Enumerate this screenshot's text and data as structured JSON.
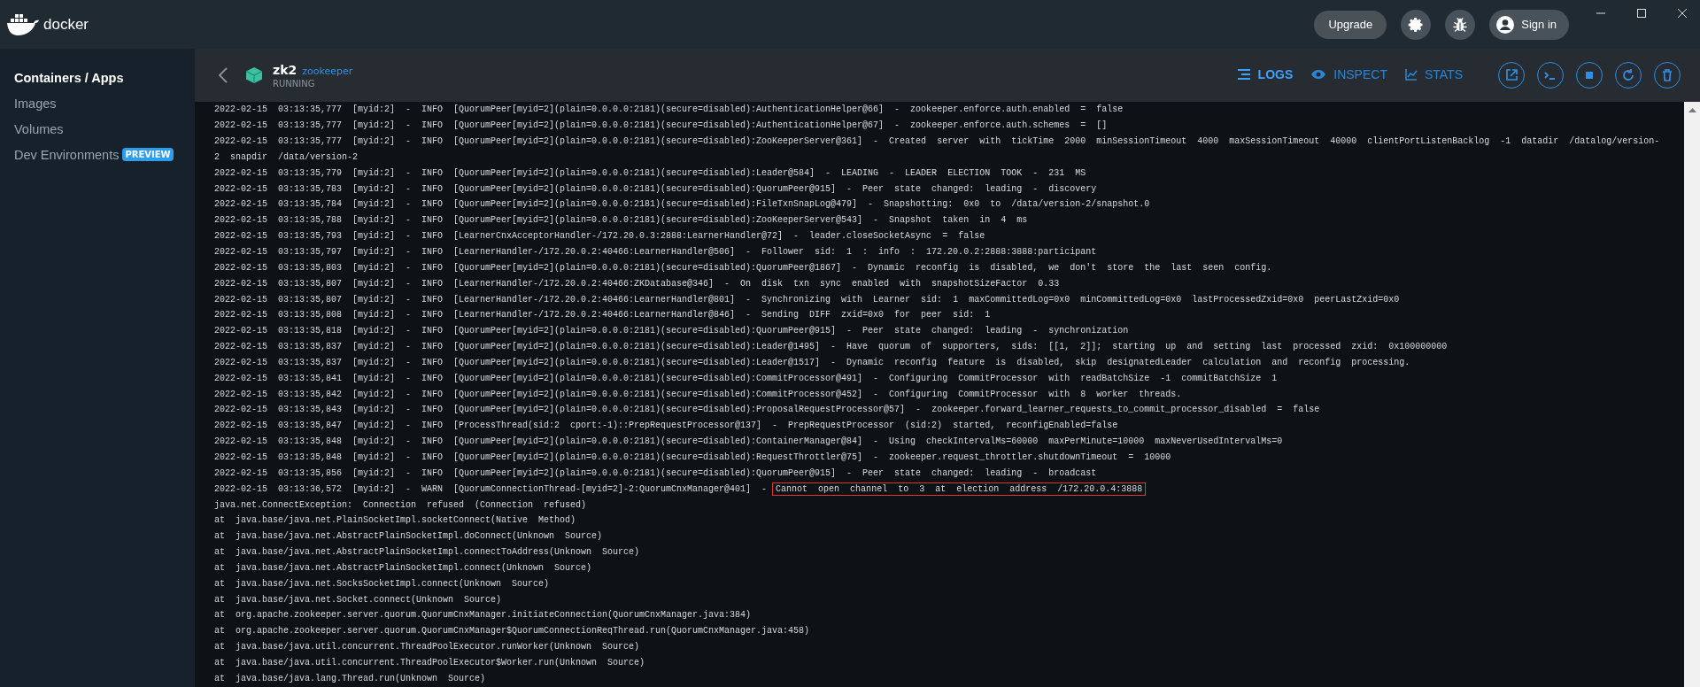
{
  "app": {
    "brand": "docker"
  },
  "header": {
    "upgrade": "Upgrade",
    "sign_in": "Sign in"
  },
  "sidebar": {
    "items": [
      {
        "label": "Containers / Apps",
        "selected": true
      },
      {
        "label": "Images",
        "selected": false
      },
      {
        "label": "Volumes",
        "selected": false
      },
      {
        "label": "Dev Environments",
        "selected": false,
        "badge": "PREVIEW"
      }
    ]
  },
  "container": {
    "name": "zk2",
    "image": "zookeeper",
    "status": "RUNNING"
  },
  "tabs": [
    {
      "label": "LOGS",
      "selected": true
    },
    {
      "label": "INSPECT",
      "selected": false
    },
    {
      "label": "STATS",
      "selected": false
    }
  ],
  "log": {
    "rows": [
      {
        "text": "2022-02-15 03:13:35,777 [myid:2] - INFO [QuorumPeer[myid=2](plain=0.0.0.0:2181)(secure=disabled):AuthenticationHelper@66] - zookeeper.enforce.auth.enabled = false"
      },
      {
        "text": "2022-02-15 03:13:35,777 [myid:2] - INFO [QuorumPeer[myid=2](plain=0.0.0.0:2181)(secure=disabled):AuthenticationHelper@67] - zookeeper.enforce.auth.schemes = []"
      },
      {
        "text": "2022-02-15 03:13:35,777 [myid:2] - INFO [QuorumPeer[myid=2](plain=0.0.0.0:2181)(secure=disabled):ZooKeeperServer@361] - Created server with tickTime 2000 minSessionTimeout 4000 maxSessionTimeout 40000 clientPortListenBacklog -1 datadir /datalog/version-"
      },
      {
        "text": "2 snapdir /data/version-2"
      },
      {
        "text": "2022-02-15 03:13:35,779 [myid:2] - INFO [QuorumPeer[myid=2](plain=0.0.0.0:2181)(secure=disabled):Leader@584] - LEADING - LEADER ELECTION TOOK - 231 MS"
      },
      {
        "text": "2022-02-15 03:13:35,783 [myid:2] - INFO [QuorumPeer[myid=2](plain=0.0.0.0:2181)(secure=disabled):QuorumPeer@915] - Peer state changed: leading - discovery"
      },
      {
        "text": "2022-02-15 03:13:35,784 [myid:2] - INFO [QuorumPeer[myid=2](plain=0.0.0.0:2181)(secure=disabled):FileTxnSnapLog@479] - Snapshotting: 0x0 to /data/version-2/snapshot.0"
      },
      {
        "text": "2022-02-15 03:13:35,788 [myid:2] - INFO [QuorumPeer[myid=2](plain=0.0.0.0:2181)(secure=disabled):ZooKeeperServer@543] - Snapshot taken in 4 ms"
      },
      {
        "text": "2022-02-15 03:13:35,793 [myid:2] - INFO [LearnerCnxAcceptorHandler-/172.20.0.3:2888:LearnerHandler@72] - leader.closeSocketAsync = false"
      },
      {
        "text": "2022-02-15 03:13:35,797 [myid:2] - INFO [LearnerHandler-/172.20.0.2:40466:LearnerHandler@506] - Follower sid: 1 : info : 172.20.0.2:2888:3888:participant"
      },
      {
        "text": "2022-02-15 03:13:35,803 [myid:2] - INFO [QuorumPeer[myid=2](plain=0.0.0.0:2181)(secure=disabled):QuorumPeer@1867] - Dynamic reconfig is disabled, we don't store the last seen config."
      },
      {
        "text": "2022-02-15 03:13:35,807 [myid:2] - INFO [LearnerHandler-/172.20.0.2:40466:ZKDatabase@346] - On disk txn sync enabled with snapshotSizeFactor 0.33"
      },
      {
        "text": "2022-02-15 03:13:35,807 [myid:2] - INFO [LearnerHandler-/172.20.0.2:40466:LearnerHandler@801] - Synchronizing with Learner sid: 1 maxCommittedLog=0x0 minCommittedLog=0x0 lastProcessedZxid=0x0 peerLastZxid=0x0"
      },
      {
        "text": "2022-02-15 03:13:35,808 [myid:2] - INFO [LearnerHandler-/172.20.0.2:40466:LearnerHandler@846] - Sending DIFF zxid=0x0 for peer sid: 1"
      },
      {
        "text": "2022-02-15 03:13:35,818 [myid:2] - INFO [QuorumPeer[myid=2](plain=0.0.0.0:2181)(secure=disabled):QuorumPeer@915] - Peer state changed: leading - synchronization"
      },
      {
        "text": "2022-02-15 03:13:35,837 [myid:2] - INFO [QuorumPeer[myid=2](plain=0.0.0.0:2181)(secure=disabled):Leader@1495] - Have quorum of supporters, sids: [[1, 2]]; starting up and setting last processed zxid: 0x100000000"
      },
      {
        "text": "2022-02-15 03:13:35,837 [myid:2] - INFO [QuorumPeer[myid=2](plain=0.0.0.0:2181)(secure=disabled):Leader@1517] - Dynamic reconfig feature is disabled, skip designatedLeader calculation and reconfig processing."
      },
      {
        "text": "2022-02-15 03:13:35,841 [myid:2] - INFO [QuorumPeer[myid=2](plain=0.0.0.0:2181)(secure=disabled):CommitProcessor@491] - Configuring CommitProcessor with readBatchSize -1 commitBatchSize 1"
      },
      {
        "text": "2022-02-15 03:13:35,842 [myid:2] - INFO [QuorumPeer[myid=2](plain=0.0.0.0:2181)(secure=disabled):CommitProcessor@452] - Configuring CommitProcessor with 8 worker threads."
      },
      {
        "text": "2022-02-15 03:13:35,843 [myid:2] - INFO [QuorumPeer[myid=2](plain=0.0.0.0:2181)(secure=disabled):ProposalRequestProcessor@57] - zookeeper.forward_learner_requests_to_commit_processor_disabled = false"
      },
      {
        "text": "2022-02-15 03:13:35,847 [myid:2] - INFO [ProcessThread(sid:2 cport:-1)::PrepRequestProcessor@137] - PrepRequestProcessor (sid:2) started, reconfigEnabled=false"
      },
      {
        "text": "2022-02-15 03:13:35,848 [myid:2] - INFO [QuorumPeer[myid=2](plain=0.0.0.0:2181)(secure=disabled):ContainerManager@84] - Using checkIntervalMs=60000 maxPerMinute=10000 maxNeverUsedIntervalMs=0"
      },
      {
        "text": "2022-02-15 03:13:35,848 [myid:2] - INFO [QuorumPeer[myid=2](plain=0.0.0.0:2181)(secure=disabled):RequestThrottler@75] - zookeeper.request_throttler.shutdownTimeout = 10000"
      },
      {
        "text": "2022-02-15 03:13:35,856 [myid:2] - INFO [QuorumPeer[myid=2](plain=0.0.0.0:2181)(secure=disabled):QuorumPeer@915] - Peer state changed: leading - broadcast"
      },
      {
        "text": "2022-02-15 03:13:36,572 [myid:2] - WARN [QuorumConnectionThread-[myid=2]-2:QuorumCnxManager@401] -",
        "highlight": "Cannot open channel to 3 at election address /172.20.0.4:3888"
      },
      {
        "text": "java.net.ConnectException: Connection refused (Connection refused)"
      },
      {
        "text": "at java.base/java.net.PlainSocketImpl.socketConnect(Native Method)"
      },
      {
        "text": "at java.base/java.net.AbstractPlainSocketImpl.doConnect(Unknown Source)"
      },
      {
        "text": "at java.base/java.net.AbstractPlainSocketImpl.connectToAddress(Unknown Source)"
      },
      {
        "text": "at java.base/java.net.AbstractPlainSocketImpl.connect(Unknown Source)"
      },
      {
        "text": "at java.base/java.net.SocksSocketImpl.connect(Unknown Source)"
      },
      {
        "text": "at java.base/java.net.Socket.connect(Unknown Source)"
      },
      {
        "text": "at org.apache.zookeeper.server.quorum.QuorumCnxManager.initiateConnection(QuorumCnxManager.java:384)"
      },
      {
        "text": "at org.apache.zookeeper.server.quorum.QuorumCnxManager$QuorumConnectionReqThread.run(QuorumCnxManager.java:458)"
      },
      {
        "text": "at java.base/java.util.concurrent.ThreadPoolExecutor.runWorker(Unknown Source)"
      },
      {
        "text": "at java.base/java.util.concurrent.ThreadPoolExecutor$Worker.run(Unknown Source)"
      },
      {
        "text": "at java.base/java.lang.Thread.run(Unknown Source)"
      }
    ]
  }
}
